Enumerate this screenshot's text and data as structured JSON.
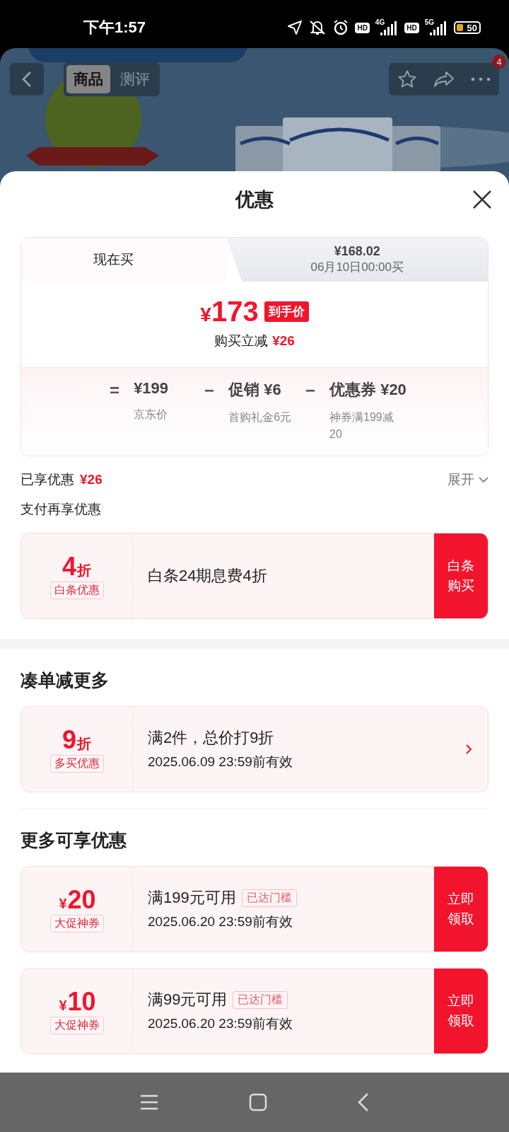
{
  "status_bar": {
    "time": "下午1:57",
    "sim_1_label": "HD",
    "network_1": "4G",
    "sim_2_label": "HD",
    "network_2": "5G",
    "battery": "50"
  },
  "header": {
    "tabs": [
      {
        "label": "商品",
        "selected": true
      },
      {
        "label": "测评",
        "selected": false
      }
    ],
    "badge": "4"
  },
  "sheet": {
    "title": "优惠",
    "price_tabs": [
      {
        "label": "现在买",
        "selected": true
      },
      {
        "price": "¥168.02",
        "label": "06月10日00:00买",
        "selected": false
      }
    ],
    "final_price": {
      "currency": "¥",
      "amount": "173",
      "tag": "到手价",
      "saving_label": "购买立减",
      "saving": "¥26"
    },
    "breakdown": [
      {
        "operator": "=",
        "value": "¥199",
        "note": "京东价"
      },
      {
        "operator": "−",
        "value": "促销 ¥6",
        "note": "首购礼金6元"
      },
      {
        "operator": "−",
        "value": "优惠券 ¥20",
        "note": "神券满199减20"
      }
    ],
    "enjoyed": {
      "label": "已享优惠",
      "amount": "¥26",
      "toggle": "展开"
    },
    "sections": [
      {
        "title": "支付再享优惠",
        "kind": "plain",
        "offers": [
          {
            "kind": "button",
            "big": "4",
            "unit": "折",
            "tag": "白条优惠",
            "title": "白条24期息费4折",
            "action": "白条购买"
          }
        ]
      },
      {
        "title": "凑单减更多",
        "kind": "heading",
        "offers": [
          {
            "kind": "arrow",
            "big": "9",
            "unit": "折",
            "tag": "多买优惠",
            "title": "满2件，总价打9折",
            "expiry": "2025.06.09 23:59前有效"
          }
        ]
      },
      {
        "title": "更多可享优惠",
        "kind": "heading",
        "offers": [
          {
            "kind": "button",
            "currency": "¥",
            "big": "20",
            "tag": "大促神券",
            "title": "满199元可用",
            "badge": "已达门槛",
            "expiry": "2025.06.20 23:59前有效",
            "action": "立即领取"
          },
          {
            "kind": "button",
            "currency": "¥",
            "big": "10",
            "tag": "大促神券",
            "title": "满99元可用",
            "badge": "已达门槛",
            "expiry": "2025.06.20 23:59前有效",
            "action": "立即领取"
          }
        ]
      }
    ]
  }
}
